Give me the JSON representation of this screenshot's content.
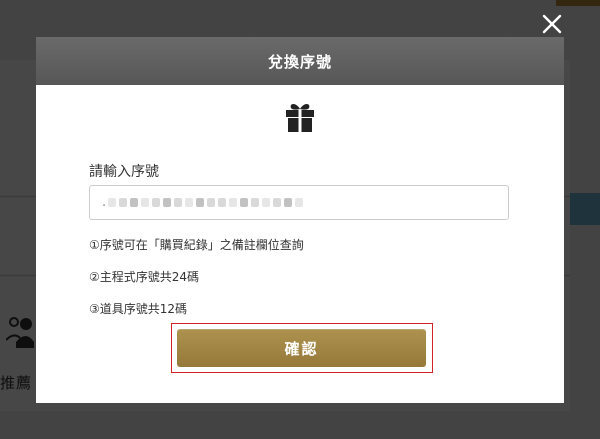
{
  "background": {
    "fragment_text": "推薦"
  },
  "close": {
    "icon": "close-icon"
  },
  "modal": {
    "title": "兌換序號",
    "gift_icon": "gift-icon",
    "input_label": "請輸入序號",
    "input_value": ".",
    "notes": [
      "①序號可在「購買紀錄」之備註欄位查詢",
      "②主程式序號共24碼",
      "③道具序號共12碼"
    ],
    "confirm_label": "確認"
  },
  "colors": {
    "header": "#5f5f5f",
    "button_gold": "#a3884a",
    "highlight_border": "#d3222a",
    "accent_blue": "#6fb6d8"
  }
}
